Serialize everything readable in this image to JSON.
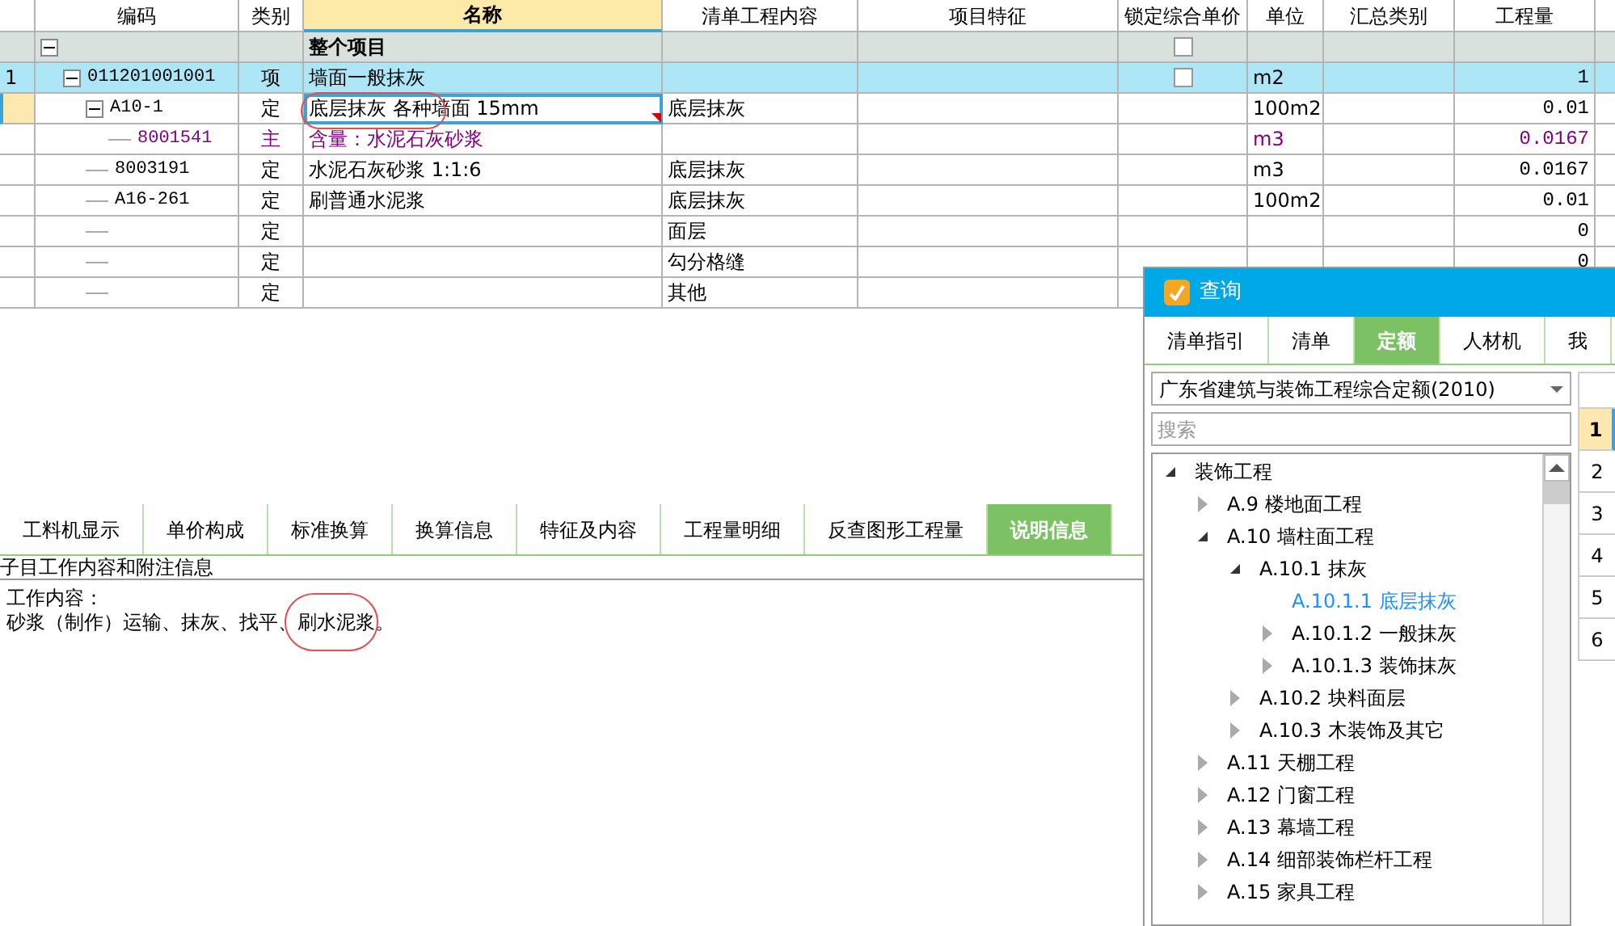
{
  "grid": {
    "columns": [
      "编码",
      "类别",
      "名称",
      "清单工程内容",
      "项目特征",
      "锁定综合单价",
      "单位",
      "汇总类别",
      "工程量"
    ],
    "rows": [
      {
        "kind": "summary",
        "name": "整个项目",
        "expanded": true,
        "locked": false,
        "selected": false,
        "children": [
          {
            "kind": "item",
            "row_number": "1",
            "code": "011201001001",
            "type": "项",
            "name": "墙面一般抹灰",
            "unit": "m2",
            "quantity": "1",
            "expanded": true,
            "locked": false,
            "selected": false,
            "children": [
              {
                "kind": "quota",
                "code": "A10-1",
                "type": "定",
                "name": "底层抹灰 各种墙面 15mm",
                "content": "底层抹灰",
                "unit": "100m2",
                "quantity": "0.01",
                "expanded": true,
                "selected": true,
                "has_note": true,
                "children": [
                  {
                    "kind": "material",
                    "code": "8001541",
                    "type": "主",
                    "name": "含量：水泥石灰砂浆",
                    "unit": "m3",
                    "quantity": "0.0167",
                    "selected": false
                  }
                ]
              },
              {
                "kind": "quota",
                "code": "8003191",
                "type": "定",
                "name": "水泥石灰砂浆 1:1:6",
                "content": "底层抹灰",
                "unit": "m3",
                "quantity": "0.0167",
                "selected": false
              },
              {
                "kind": "quota",
                "code": "A16-261",
                "type": "定",
                "name": "刷普通水泥浆",
                "content": "底层抹灰",
                "unit": "100m2",
                "quantity": "0.01",
                "selected": false
              },
              {
                "kind": "quota",
                "type": "定",
                "content": "面层",
                "quantity": "0",
                "selected": false
              },
              {
                "kind": "quota",
                "type": "定",
                "content": "勾分格缝",
                "quantity": "0",
                "selected": false
              },
              {
                "kind": "quota",
                "type": "定",
                "content": "其他",
                "selected": false
              }
            ]
          }
        ]
      }
    ]
  },
  "detail_tabs": [
    {
      "label": "工料机显示",
      "selected": false
    },
    {
      "label": "单价构成",
      "selected": false
    },
    {
      "label": "标准换算",
      "selected": false
    },
    {
      "label": "换算信息",
      "selected": false
    },
    {
      "label": "特征及内容",
      "selected": false
    },
    {
      "label": "工程量明细",
      "selected": false
    },
    {
      "label": "反查图形工程量",
      "selected": false
    },
    {
      "label": "说明信息",
      "selected": true
    }
  ],
  "detail": {
    "heading": "子目工作内容和附注信息",
    "lines": [
      "工作内容：",
      "砂浆（制作）运输、抹灰、找平、刷水泥浆。"
    ]
  },
  "query_panel": {
    "title": "查询",
    "tabs": [
      {
        "label": "清单指引",
        "selected": false
      },
      {
        "label": "清单",
        "selected": false
      },
      {
        "label": "定额",
        "selected": true
      },
      {
        "label": "人材机",
        "selected": false
      },
      {
        "label": "我",
        "selected": false
      }
    ],
    "library": "广东省建筑与装饰工程综合定额(2010)",
    "search": {
      "placeholder": "搜索"
    },
    "tree": [
      {
        "label": "装饰工程",
        "expanded": true,
        "selected": false,
        "children": [
          {
            "label": "A.9 楼地面工程",
            "expanded": false,
            "selected": false
          },
          {
            "label": "A.10 墙柱面工程",
            "expanded": true,
            "selected": false,
            "children": [
              {
                "label": "A.10.1 抹灰",
                "expanded": true,
                "selected": false,
                "children": [
                  {
                    "label": "A.10.1.1 底层抹灰",
                    "selected": true
                  },
                  {
                    "label": "A.10.1.2 一般抹灰",
                    "expanded": false,
                    "selected": false
                  },
                  {
                    "label": "A.10.1.3 装饰抹灰",
                    "expanded": false,
                    "selected": false
                  }
                ]
              },
              {
                "label": "A.10.2 块料面层",
                "expanded": false,
                "selected": false
              },
              {
                "label": "A.10.3 木装饰及其它",
                "expanded": false,
                "selected": false
              }
            ]
          },
          {
            "label": "A.11 天棚工程",
            "expanded": false,
            "selected": false
          },
          {
            "label": "A.12 门窗工程",
            "expanded": false,
            "selected": false
          },
          {
            "label": "A.13 幕墙工程",
            "expanded": false,
            "selected": false
          },
          {
            "label": "A.14 细部装饰栏杆工程",
            "expanded": false,
            "selected": false
          },
          {
            "label": "A.15 家具工程",
            "expanded": false,
            "selected": false
          }
        ]
      }
    ],
    "results": [
      {
        "label": "1",
        "selected": true
      },
      {
        "label": "2",
        "selected": false
      },
      {
        "label": "3",
        "selected": false
      },
      {
        "label": "4",
        "selected": false
      },
      {
        "label": "5",
        "selected": false
      },
      {
        "label": "6",
        "selected": false
      }
    ]
  }
}
